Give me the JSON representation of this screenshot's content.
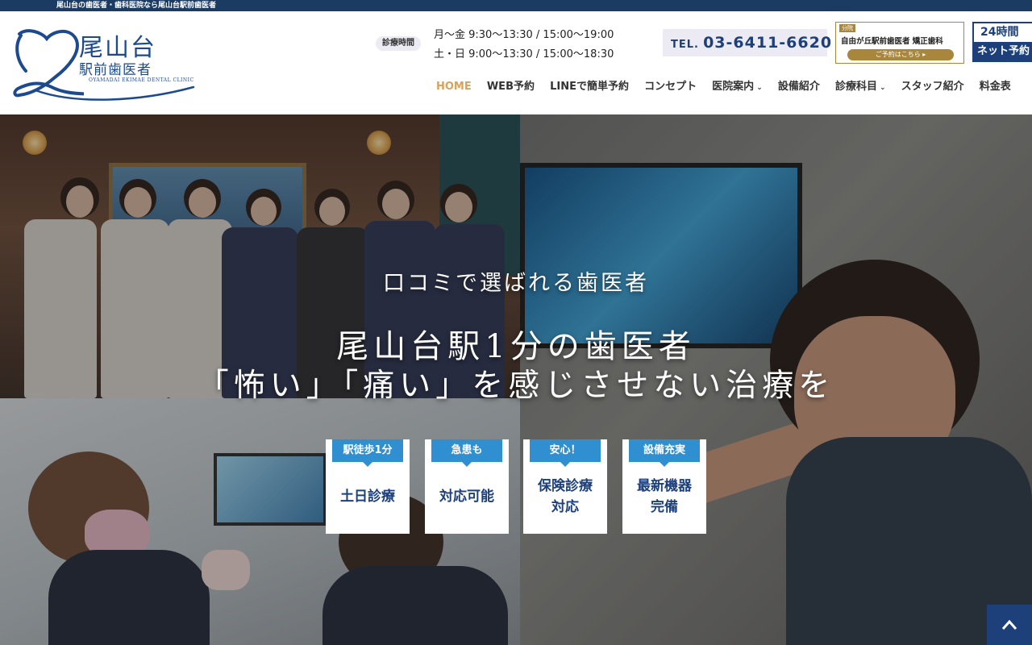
{
  "topbar": {
    "text": "尾山台の歯医者・歯科医院なら尾山台駅前歯医者"
  },
  "logo": {
    "main": "尾山台",
    "sub": "駅前歯医者",
    "en": "OYAMADAI EKIMAE DENTAL CLINIC"
  },
  "hours": {
    "label": "診療時間",
    "weekday": "月～金 9:30～13:30 / 15:00～19:00",
    "weekend": "土・日 9:00～13:30 / 15:00～18:30"
  },
  "tel": {
    "prefix": "TEL.",
    "number": "03-6411-6620"
  },
  "banner_ortho": {
    "tag": "分院",
    "text": "自由が丘駅前歯医者 矯正歯科",
    "button": "ご予約はこちら ▸"
  },
  "banner_net": {
    "line1": "24時間",
    "line2": "ネット予約"
  },
  "nav": {
    "items": [
      {
        "label": "HOME",
        "active": true
      },
      {
        "label": "WEB予約"
      },
      {
        "label": "LINEで簡単予約"
      },
      {
        "label": "コンセプト"
      },
      {
        "label": "医院案内",
        "chevron": "⌄"
      },
      {
        "label": "設備紹介"
      },
      {
        "label": "診療科目",
        "chevron": "⌄"
      },
      {
        "label": "スタッフ紹介"
      },
      {
        "label": "料金表"
      }
    ]
  },
  "hero": {
    "catch1": "口コミで選ばれる歯医者",
    "catch2": "尾山台駅1分の歯医者",
    "catch3": "「怖い」「痛い」を感じさせない治療を"
  },
  "badges": [
    {
      "tag": "駅徒歩1分",
      "main": "土日診療"
    },
    {
      "tag": "急患も",
      "main": "対応可能"
    },
    {
      "tag": "安心！",
      "main": "保険診療\n対応"
    },
    {
      "tag": "設備充実",
      "main": "最新機器\n完備"
    }
  ],
  "scroll_top": {
    "icon": "chevron-up-icon",
    "glyph": "^"
  },
  "colors": {
    "navy": "#1b3b63",
    "accent": "#d9a25a",
    "badge_blue": "#2f8fd0",
    "gold": "#a8873c"
  }
}
